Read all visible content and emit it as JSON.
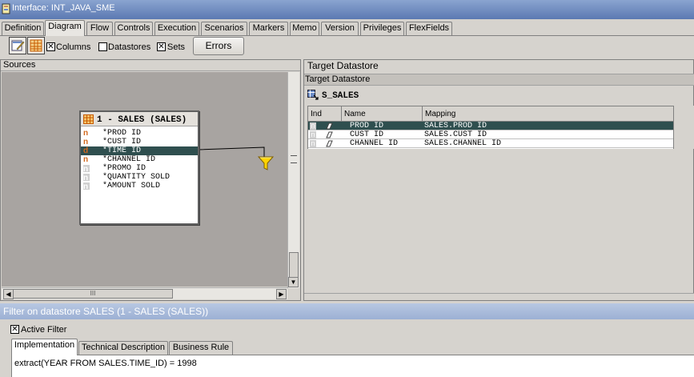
{
  "window": {
    "title": "Interface: INT_JAVA_SME"
  },
  "tabs": [
    {
      "label": "Definition"
    },
    {
      "label": "Diagram"
    },
    {
      "label": "Flow"
    },
    {
      "label": "Controls"
    },
    {
      "label": "Execution"
    },
    {
      "label": "Scenarios"
    },
    {
      "label": "Markers"
    },
    {
      "label": "Memo"
    },
    {
      "label": "Version"
    },
    {
      "label": "Privileges"
    },
    {
      "label": "FlexFields"
    }
  ],
  "toolbar": {
    "columns_label": "Columns",
    "columns_checked": true,
    "datastores_label": "Datastores",
    "datastores_checked": false,
    "sets_label": "Sets",
    "sets_checked": true,
    "errors_label": "Errors"
  },
  "sources": {
    "header": "Sources",
    "datastore": {
      "title": "1 - SALES (SALES)",
      "columns": [
        {
          "ind": "n",
          "name": "*PROD ID",
          "selected": false
        },
        {
          "ind": "n",
          "name": "*CUST ID",
          "selected": false
        },
        {
          "ind": "d",
          "name": "*TIME ID",
          "selected": true
        },
        {
          "ind": "n",
          "name": "*CHANNEL ID",
          "selected": false
        },
        {
          "ind": "n",
          "name": "*PROMO ID",
          "selected": false
        },
        {
          "ind": "n",
          "name": "*QUANTITY SOLD",
          "selected": false
        },
        {
          "ind": "n",
          "name": "*AMOUNT SOLD",
          "selected": false
        }
      ]
    },
    "hscroll_grip": "III"
  },
  "target": {
    "header": "Target Datastore",
    "subheader": "Target Datastore",
    "name": "S_SALES",
    "columns": [
      "Ind",
      "Name",
      "Mapping"
    ],
    "rows": [
      {
        "ind": "n",
        "name": "PROD ID",
        "mapping": "SALES.PROD ID",
        "selected": true
      },
      {
        "ind": "n",
        "name": "CUST ID",
        "mapping": "SALES.CUST ID",
        "selected": false
      },
      {
        "ind": "n",
        "name": "CHANNEL ID",
        "mapping": "SALES.CHANNEL ID",
        "selected": false
      }
    ]
  },
  "filter": {
    "title": "Filter on datastore SALES (1 - SALES (SALES))",
    "active_label": "Active Filter",
    "active_checked": true,
    "tabs": [
      {
        "label": "Implementation"
      },
      {
        "label": "Technical Description"
      },
      {
        "label": "Business Rule"
      }
    ],
    "expression": "extract(YEAR FROM SALES.TIME_ID) = 1998"
  },
  "colors": {
    "selection": "#2f4f4f",
    "canvas": "#a8a4a1",
    "filter_bar": "#9cb0d4"
  }
}
